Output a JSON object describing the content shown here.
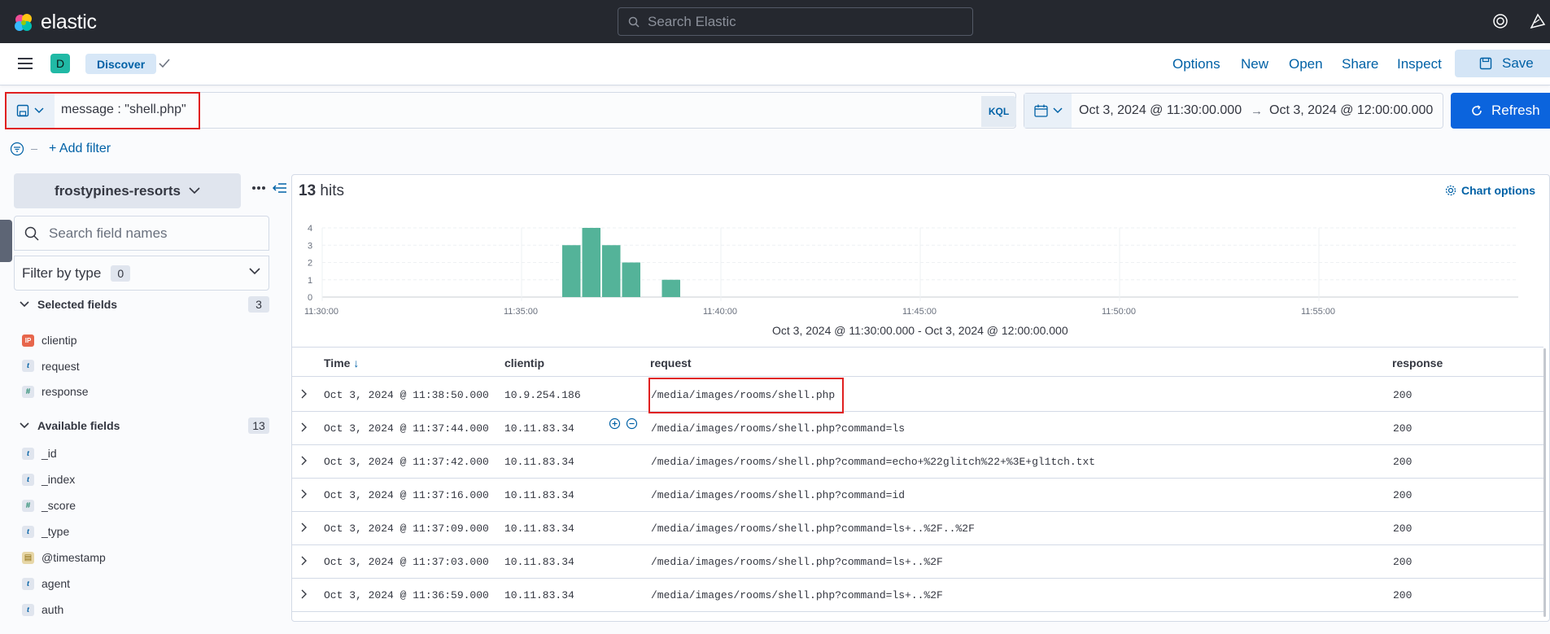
{
  "topbar": {
    "logo_text": "elastic",
    "search_placeholder": "Search Elastic",
    "icons": [
      "help-icon",
      "newsfeed-icon"
    ]
  },
  "appbar": {
    "space_initial": "D",
    "breadcrumb": "Discover",
    "links": [
      "Options",
      "New",
      "Open",
      "Share",
      "Inspect"
    ],
    "save_label": "Save"
  },
  "query": {
    "text": "message : \"shell.php\"",
    "language": "KQL"
  },
  "date_range": {
    "start": "Oct 3, 2024 @ 11:30:00.000",
    "arrow": "→",
    "end": "Oct 3, 2024 @ 12:00:00.000",
    "refresh_label": "Refresh"
  },
  "filters": {
    "add_label": "+ Add filter"
  },
  "sidebar": {
    "index_pattern": "frostypines-resorts",
    "search_placeholder": "Search field names",
    "filter_by_type_label": "Filter by type",
    "filter_by_type_count": "0",
    "selected_fields": {
      "title": "Selected fields",
      "count": "3",
      "items": [
        {
          "type": "ip",
          "type_label": "IP",
          "name": "clientip"
        },
        {
          "type": "t",
          "type_label": "t",
          "name": "request"
        },
        {
          "type": "num",
          "type_label": "#",
          "name": "response"
        }
      ]
    },
    "available_fields": {
      "title": "Available fields",
      "count": "13",
      "items": [
        {
          "type": "t",
          "type_label": "t",
          "name": "_id"
        },
        {
          "type": "t",
          "type_label": "t",
          "name": "_index"
        },
        {
          "type": "num",
          "type_label": "#",
          "name": "_score"
        },
        {
          "type": "t",
          "type_label": "t",
          "name": "_type"
        },
        {
          "type": "date",
          "type_label": "▤",
          "name": "@timestamp"
        },
        {
          "type": "t",
          "type_label": "t",
          "name": "agent"
        },
        {
          "type": "t",
          "type_label": "t",
          "name": "auth"
        }
      ]
    }
  },
  "results": {
    "hits_count": "13",
    "hits_label": "hits",
    "chart_options_label": "Chart options",
    "range_label": "Oct 3, 2024 @ 11:30:00.000 - Oct 3, 2024 @ 12:00:00.000"
  },
  "chart_data": {
    "type": "bar",
    "x": [
      "11:36:00",
      "11:36:30",
      "11:37:00",
      "11:37:30",
      "11:38:30"
    ],
    "values": [
      3,
      4,
      3,
      2,
      1
    ],
    "x_ticks": [
      "11:30:00",
      "11:35:00",
      "11:40:00",
      "11:45:00",
      "11:50:00",
      "11:55:00"
    ],
    "y_ticks": [
      "0",
      "1",
      "2",
      "3",
      "4"
    ],
    "xlim": [
      "11:30:00",
      "12:00:00"
    ],
    "ylim": [
      0,
      4
    ],
    "bar_interval": "30 seconds",
    "color": "#54b399",
    "grid": true
  },
  "table": {
    "columns": [
      "Time",
      "clientip",
      "request",
      "response"
    ],
    "rows": [
      {
        "time": "Oct 3, 2024 @ 11:38:50.000",
        "clientip": "10.9.254.186",
        "request": "/media/images/rooms/shell.php",
        "response": "200"
      },
      {
        "time": "Oct 3, 2024 @ 11:37:44.000",
        "clientip": "10.11.83.34",
        "request": "/media/images/rooms/shell.php?command=ls",
        "response": "200"
      },
      {
        "time": "Oct 3, 2024 @ 11:37:42.000",
        "clientip": "10.11.83.34",
        "request": "/media/images/rooms/shell.php?command=echo+%22glitch%22+%3E+gl1tch.txt",
        "response": "200"
      },
      {
        "time": "Oct 3, 2024 @ 11:37:16.000",
        "clientip": "10.11.83.34",
        "request": "/media/images/rooms/shell.php?command=id",
        "response": "200"
      },
      {
        "time": "Oct 3, 2024 @ 11:37:09.000",
        "clientip": "10.11.83.34",
        "request": "/media/images/rooms/shell.php?command=ls+..%2F..%2F",
        "response": "200"
      },
      {
        "time": "Oct 3, 2024 @ 11:37:03.000",
        "clientip": "10.11.83.34",
        "request": "/media/images/rooms/shell.php?command=ls+..%2F",
        "response": "200"
      },
      {
        "time": "Oct 3, 2024 @ 11:36:59.000",
        "clientip": "10.11.83.34",
        "request": "/media/images/rooms/shell.php?command=ls+..%2F",
        "response": "200"
      }
    ]
  }
}
